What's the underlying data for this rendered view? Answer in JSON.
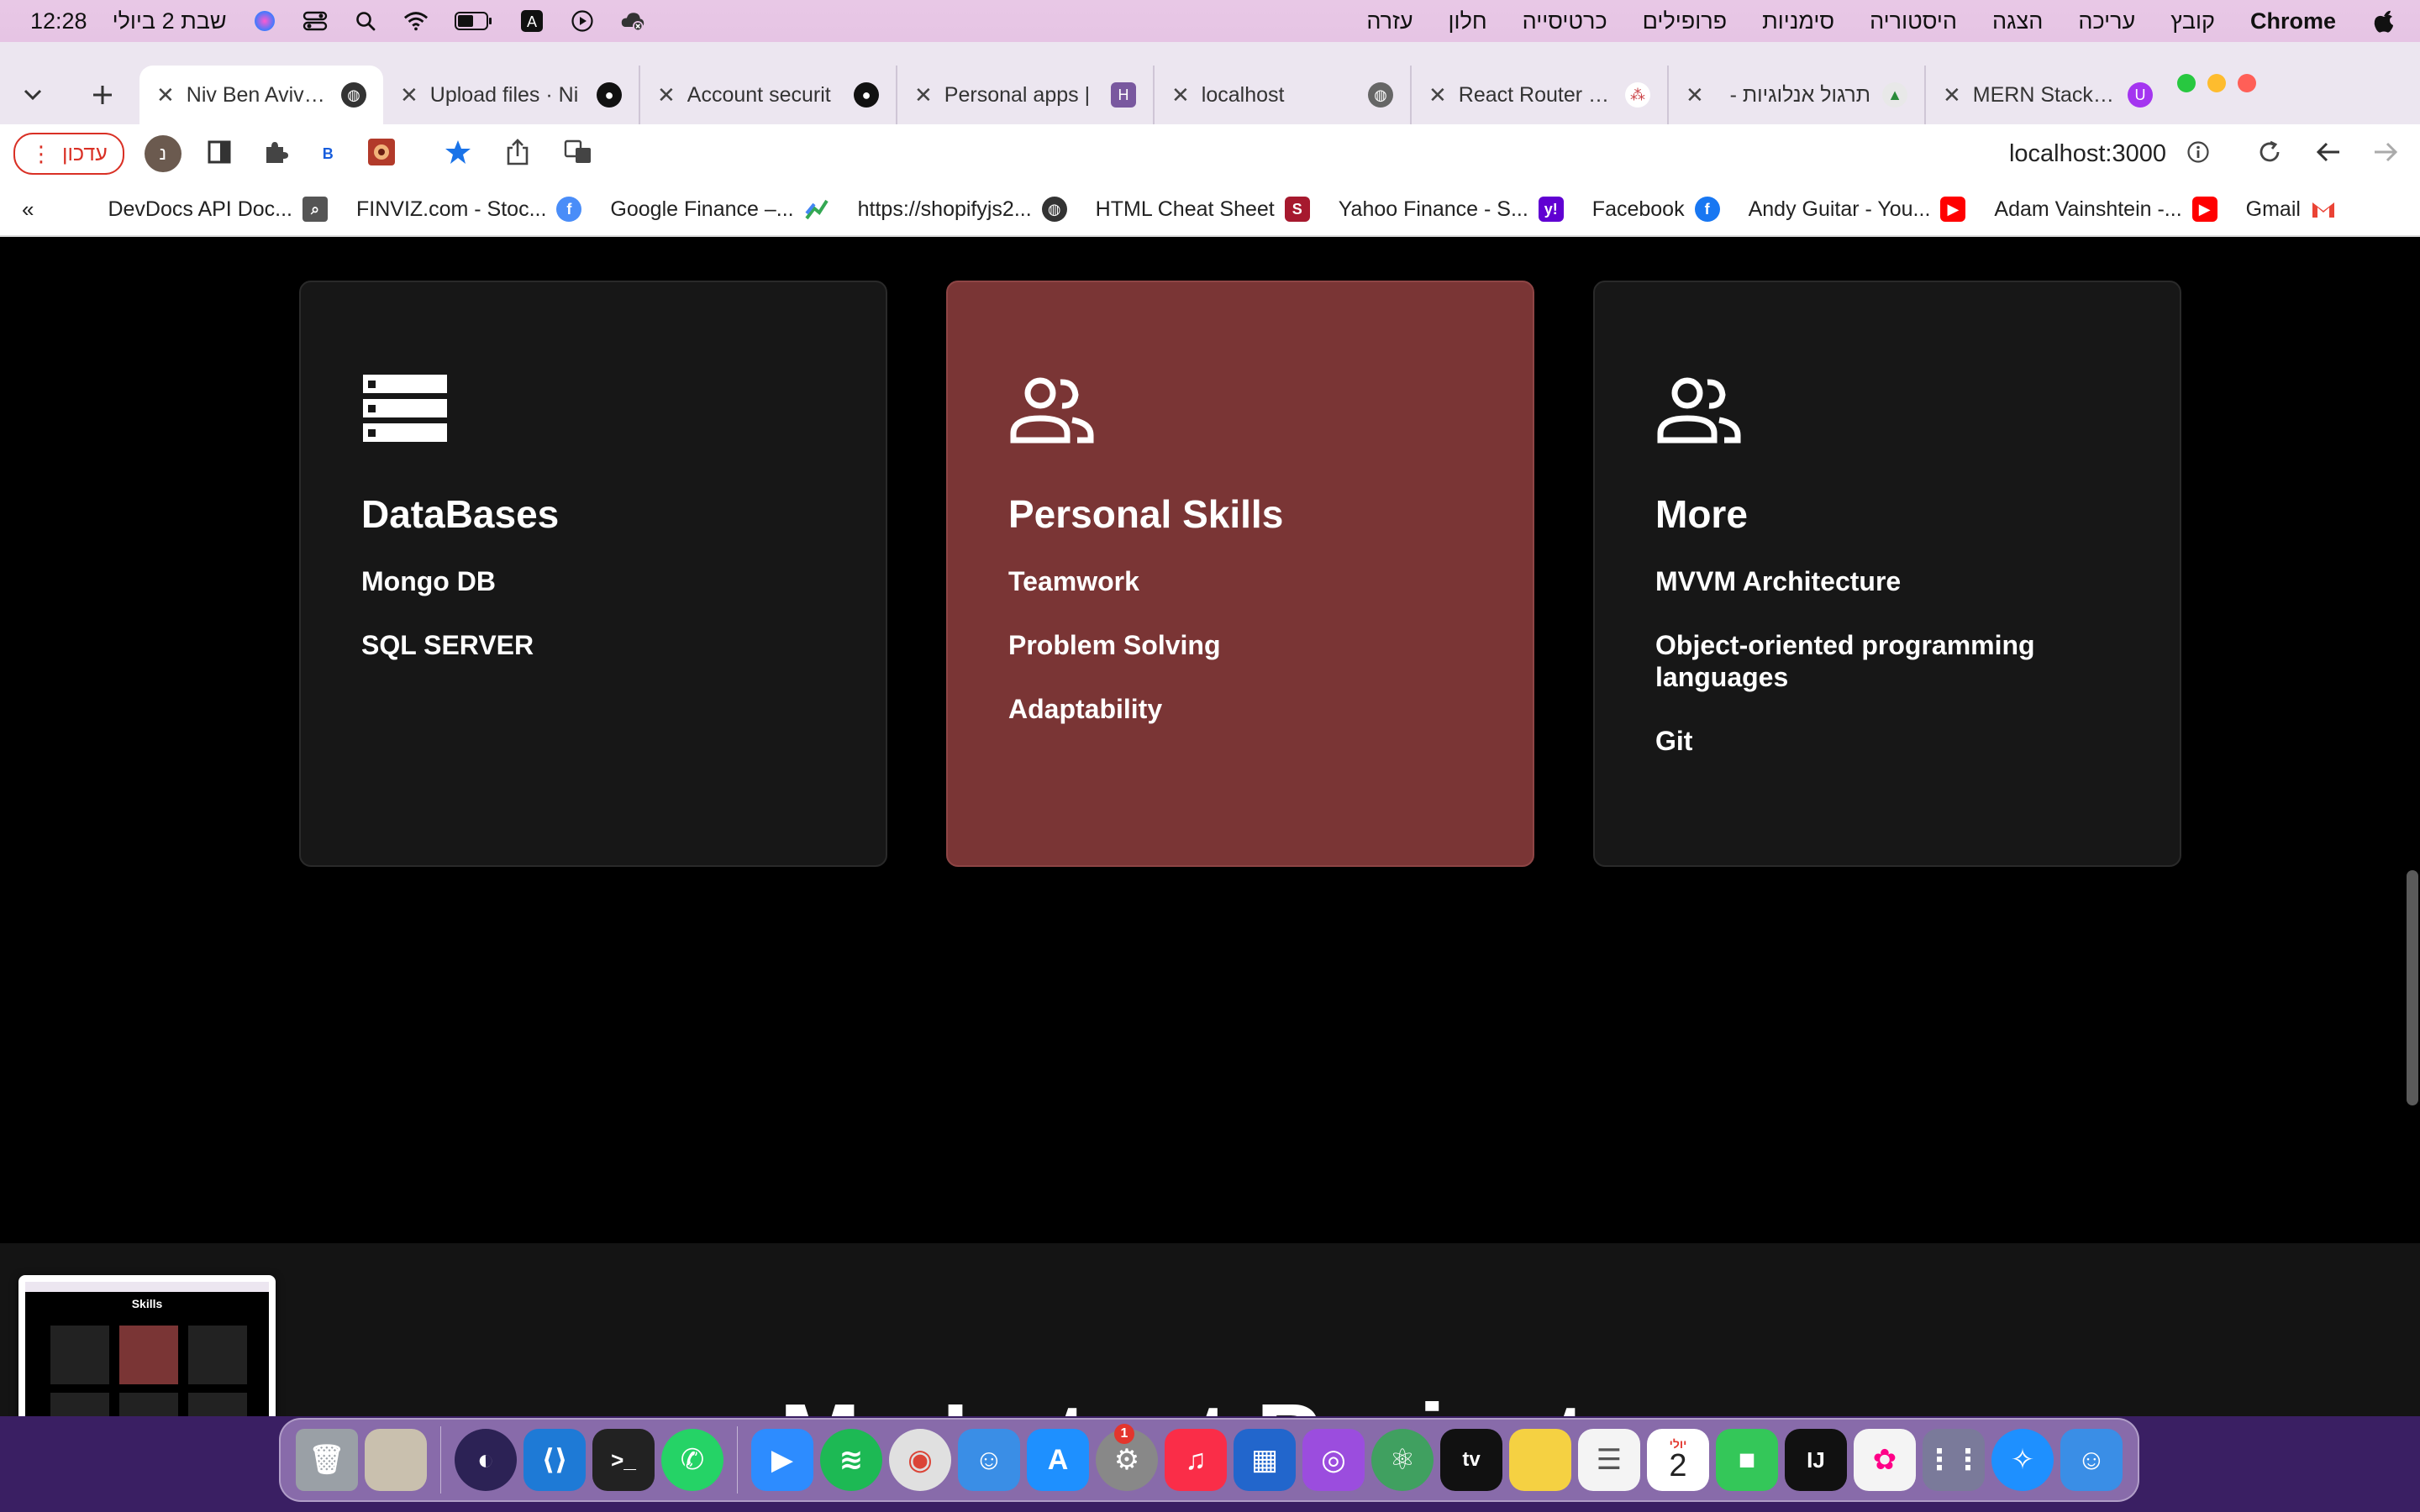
{
  "menubar": {
    "clock": "12:28",
    "date": "שבת 2 ביולי",
    "menus": [
      "עזרה",
      "חלון",
      "כרטיסייה",
      "פרופילים",
      "סימניות",
      "היסטוריה",
      "הצגה",
      "עריכה",
      "קובץ"
    ],
    "app_name": "Chrome"
  },
  "tabs": [
    {
      "title": "Niv Ben Aviv Pr",
      "icon": "globe-icon",
      "active": true
    },
    {
      "title": "Upload files · Ni",
      "icon": "github-icon",
      "active": false
    },
    {
      "title": "Account securit",
      "icon": "github-icon",
      "active": false
    },
    {
      "title": "Personal apps |",
      "icon": "heroku-icon",
      "active": false
    },
    {
      "title": "localhost",
      "icon": "globe-icon",
      "active": false
    },
    {
      "title": "React Router | C",
      "icon": "react-router-icon",
      "active": false
    },
    {
      "title": "תרגול אנלוגיות -",
      "icon": "site-icon",
      "active": false
    },
    {
      "title": "MERN Stack Co",
      "icon": "udemy-icon",
      "active": false
    }
  ],
  "toolbar": {
    "update_label": "עדכון",
    "profile_initial": "נ",
    "url": "localhost:3000"
  },
  "bookmarks": [
    {
      "label": "DevDocs API Doc...",
      "icon": "search-icon",
      "color": "#555555"
    },
    {
      "label": "FINVIZ.com - Stoc...",
      "icon": "facebook-icon",
      "color": "#4a8df8"
    },
    {
      "label": "Google Finance –...",
      "icon": "google-finance-icon",
      "color": "#34a853"
    },
    {
      "label": "https://shopifyjs2...",
      "icon": "globe-icon",
      "color": "#333333"
    },
    {
      "label": "HTML Cheat Sheet",
      "icon": "stanford-icon",
      "color": "#a6192e"
    },
    {
      "label": "Yahoo Finance - S...",
      "icon": "yahoo-icon",
      "color": "#6001d2"
    },
    {
      "label": "Facebook",
      "icon": "facebook-icon",
      "color": "#1877f2"
    },
    {
      "label": "Andy Guitar - You...",
      "icon": "youtube-icon",
      "color": "#ff0000"
    },
    {
      "label": "Adam Vainshtein -...",
      "icon": "youtube-icon",
      "color": "#ff0000"
    },
    {
      "label": "Gmail",
      "icon": "gmail-icon",
      "color": "#ea4335"
    }
  ],
  "cards": [
    {
      "title": "DataBases",
      "icon": "database-icon",
      "highlight": false,
      "items": [
        "Mongo DB",
        "SQL SERVER"
      ]
    },
    {
      "title": "Personal Skills",
      "icon": "people-icon",
      "highlight": true,
      "items": [
        "Teamwork",
        "Problem Solving",
        "Adaptability"
      ]
    },
    {
      "title": "More",
      "icon": "people-icon",
      "highlight": false,
      "items": [
        "MVVM Architecture",
        "Object-oriented programming languages",
        "Git"
      ]
    }
  ],
  "projects_title": "My Latest Projects",
  "thumbnail_title": "Skills",
  "colors": {
    "card_bg": "#171717",
    "card_highlight": "#7a3535",
    "page_bg": "#000000"
  },
  "dock": [
    {
      "name": "trash-icon",
      "color": "#9aa0a6"
    },
    {
      "name": "photos-stack-icon",
      "color": "#b8b0a0"
    },
    {
      "name": "sep"
    },
    {
      "name": "eclipse-icon",
      "color": "#2c2255"
    },
    {
      "name": "vscode-icon",
      "color": "#1e7ad6"
    },
    {
      "name": "terminal-icon",
      "color": "#222222"
    },
    {
      "name": "whatsapp-icon",
      "color": "#25d366"
    },
    {
      "name": "sep"
    },
    {
      "name": "zoom-icon",
      "color": "#2d8cff"
    },
    {
      "name": "spotify-icon",
      "color": "#1db954"
    },
    {
      "name": "chrome-icon",
      "color": "#e0e0e0"
    },
    {
      "name": "finder-icon",
      "color": "#3a8ee6"
    },
    {
      "name": "app-store-icon",
      "color": "#1e90ff"
    },
    {
      "name": "system-preferences-icon",
      "color": "#888888"
    },
    {
      "name": "music-icon",
      "color": "#fa2d48"
    },
    {
      "name": "keynote-icon",
      "color": "#2266cc"
    },
    {
      "name": "podcasts-icon",
      "color": "#9b4dde"
    },
    {
      "name": "atom-icon",
      "color": "#40a060"
    },
    {
      "name": "apple-tv-icon",
      "color": "#111111"
    },
    {
      "name": "notes-icon",
      "color": "#f5d142"
    },
    {
      "name": "reminders-icon",
      "color": "#f4f4f4"
    },
    {
      "name": "calendar-icon",
      "color": "#ffffff"
    },
    {
      "name": "facetime-icon",
      "color": "#34c759"
    },
    {
      "name": "intellij-icon",
      "color": "#111111"
    },
    {
      "name": "photos-icon",
      "color": "#f4f4f4"
    },
    {
      "name": "launchpad-icon",
      "color": "#7a7a9a"
    },
    {
      "name": "safari-icon",
      "color": "#1e90ff"
    },
    {
      "name": "finder2-icon",
      "color": "#3a8ee6"
    }
  ],
  "dock_calendar_day": "2",
  "dock_calendar_month": "יולי",
  "dock_music_badge": "1"
}
